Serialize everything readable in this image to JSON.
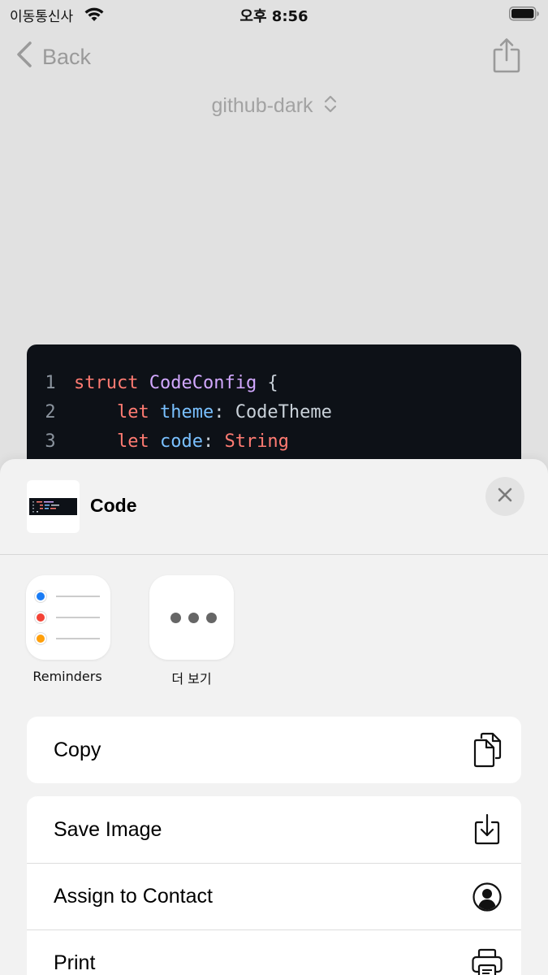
{
  "status": {
    "carrier": "이동통신사",
    "time": "오후 8:56"
  },
  "nav": {
    "back_label": "Back",
    "theme_label": "github-dark"
  },
  "code": {
    "lines": [
      {
        "num": "1",
        "tokens": [
          "struct",
          " ",
          "CodeConfig",
          " {"
        ]
      },
      {
        "num": "2",
        "tokens": [
          "    let",
          " ",
          "theme",
          ": CodeTheme"
        ]
      },
      {
        "num": "3",
        "tokens": [
          "    let",
          " ",
          "code",
          ": ",
          "String"
        ]
      }
    ]
  },
  "sheet": {
    "title": "Code",
    "apps": [
      {
        "label": "Reminders",
        "icon": "reminders-icon"
      },
      {
        "label": "더 보기",
        "icon": "more-icon"
      }
    ],
    "actions": {
      "copy": {
        "label": "Copy",
        "icon": "copy-icon"
      },
      "save_image": {
        "label": "Save Image",
        "icon": "save-icon"
      },
      "assign_contact": {
        "label": "Assign to Contact",
        "icon": "contact-icon"
      },
      "print": {
        "label": "Print",
        "icon": "printer-icon"
      }
    }
  },
  "colors": {
    "code_bg": "#0d1117",
    "keyword": "#ff7b72",
    "type": "#d2a8ff",
    "property": "#79c0ff",
    "plain": "#c9d1d9",
    "reminder_dots": [
      "#1a7cf5",
      "#f44336",
      "#ff9f0a"
    ]
  }
}
